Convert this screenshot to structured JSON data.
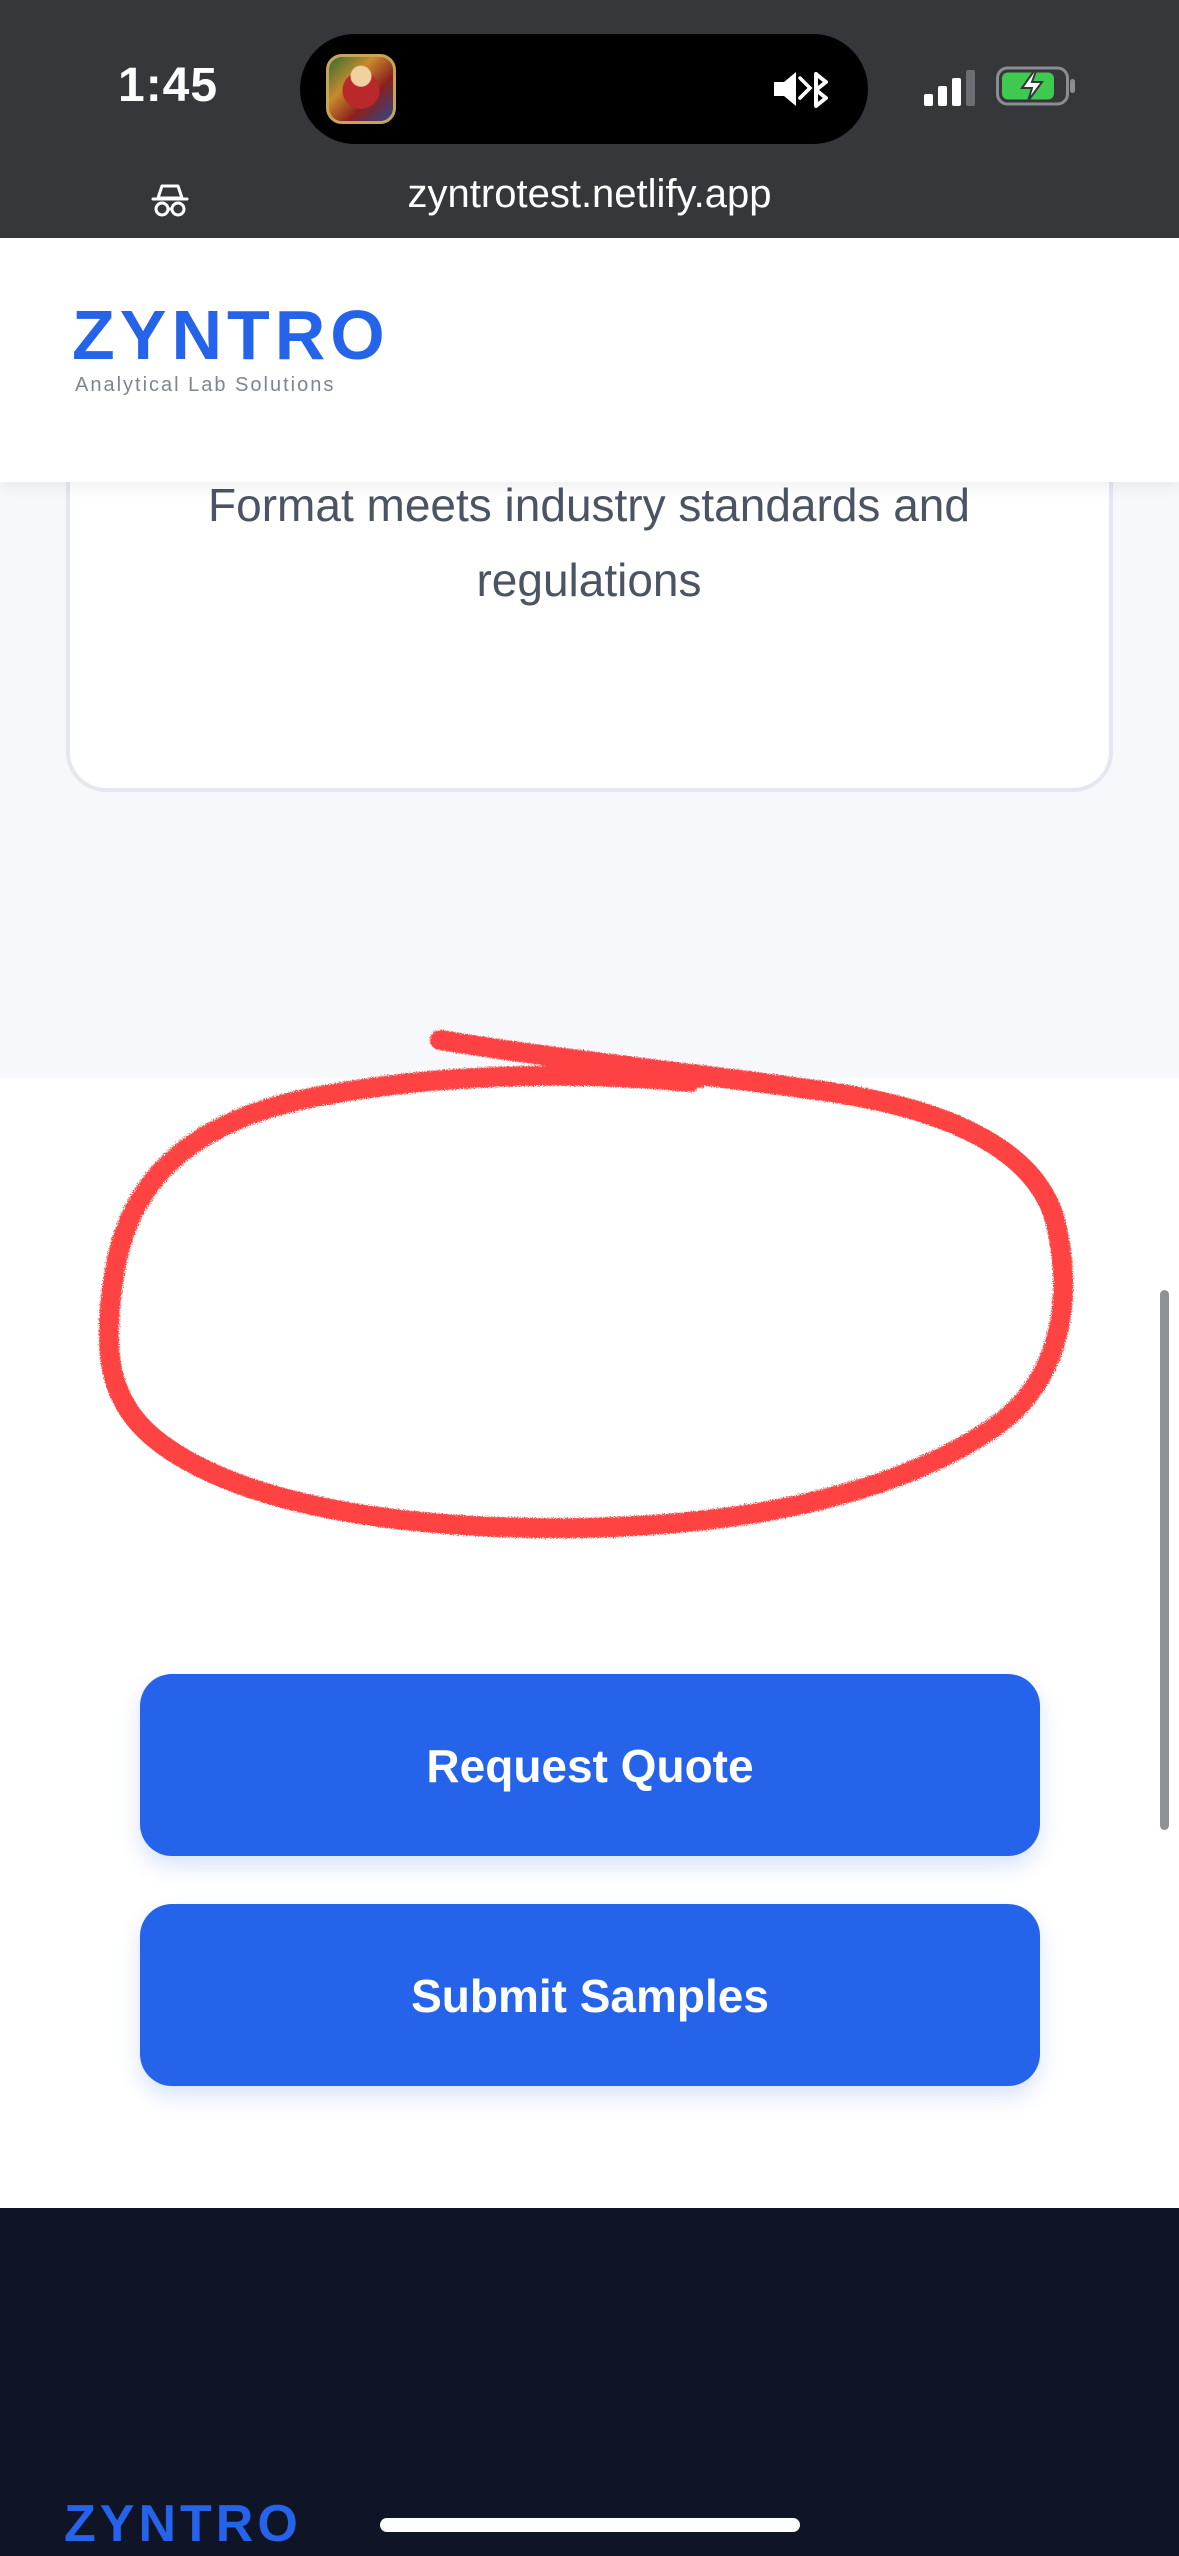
{
  "status_bar": {
    "time": "1:45",
    "icons": [
      "now-playing-artwork",
      "mute-icon",
      "bluetooth-icon",
      "signal-icon",
      "battery-charging-icon"
    ]
  },
  "browser": {
    "url": "zyntrotest.netlify.app",
    "left_icon": "incognito-icon"
  },
  "header": {
    "logo": "ZYNTRO",
    "tagline": "Analytical Lab Solutions",
    "brand_color": "#2563eb"
  },
  "feature_card": {
    "text": "Format meets industry standards and regulations"
  },
  "annotation": {
    "shape": "hand-drawn circle",
    "color": "#ff2b2b"
  },
  "cta": {
    "request_quote": "Request Quote",
    "submit_samples": "Submit Samples"
  },
  "footer": {
    "logo": "ZYNTRO",
    "background": "#0f1526"
  }
}
